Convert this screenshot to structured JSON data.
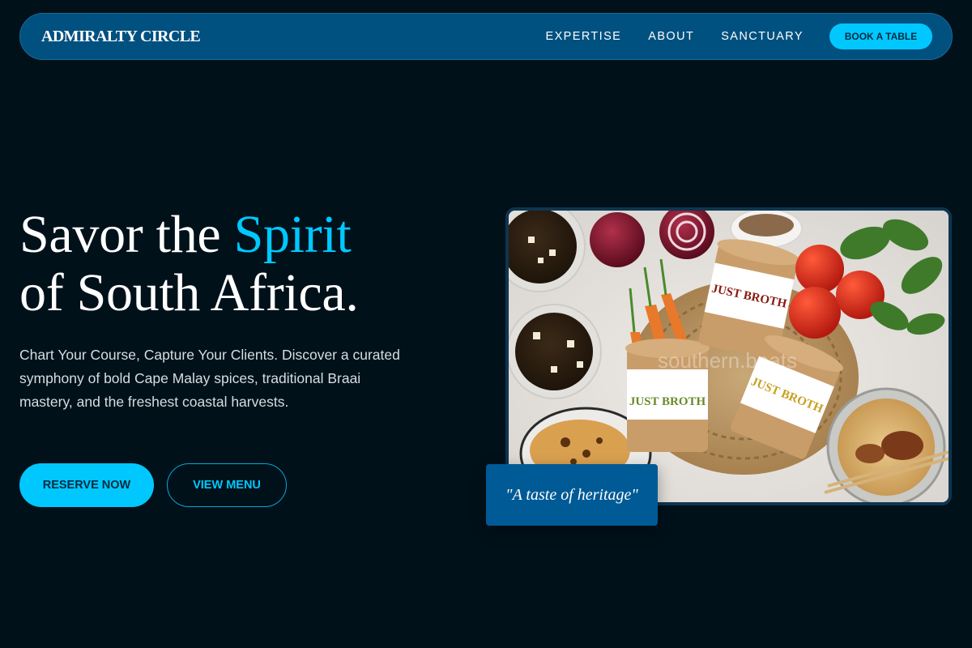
{
  "header": {
    "brand": "ADMIRALTY CIRCLE",
    "nav": [
      {
        "label": "EXPERTISE"
      },
      {
        "label": "ABOUT"
      },
      {
        "label": "SANCTUARY"
      }
    ],
    "cta_label": "BOOK A TABLE"
  },
  "hero": {
    "title_part1": "Savor the ",
    "title_accent": "Spirit",
    "title_part2": "of South Africa.",
    "description": "Chart Your Course, Capture Your Clients. Discover a curated symphony of bold Cape Malay spices, traditional Braai mastery, and the freshest coastal harvests.",
    "reserve_label": "RESERVE NOW",
    "menu_label": "VIEW MENU"
  },
  "image": {
    "product_label_1": "JUST BROTH",
    "product_label_2": "JUST BROTH",
    "product_label_3": "JUST BROTH",
    "watermark": "southern.beats"
  },
  "badge": {
    "text": "\"A taste of heritage\""
  },
  "colors": {
    "background": "#00111a",
    "nav_bg": "#005080",
    "accent": "#00c8ff",
    "badge_bg": "#005a96"
  }
}
